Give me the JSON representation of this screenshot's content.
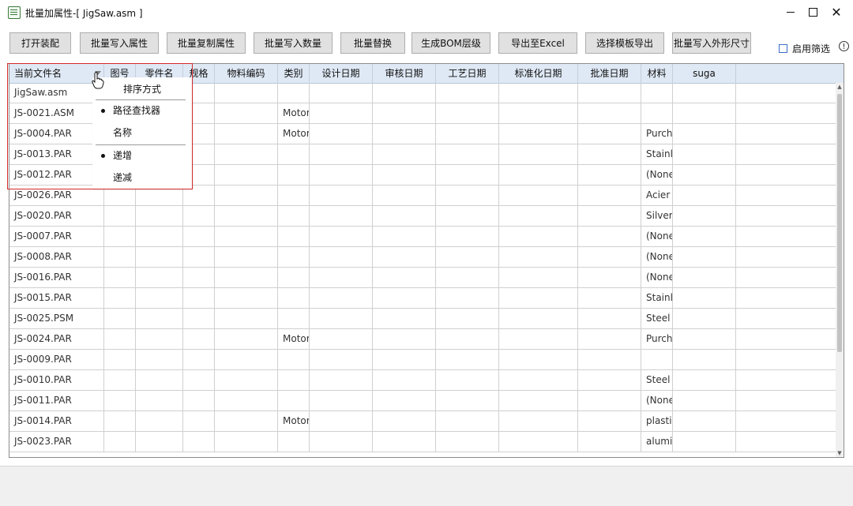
{
  "window": {
    "title": "批量加属性-[ JigSaw.asm ]",
    "minimize_icon": "minimize-icon",
    "maximize_icon": "maximize-icon",
    "close_glyph": "✕"
  },
  "toolbar": {
    "buttons": [
      "打开装配",
      "批量写入属性",
      "批量复制属性",
      "批量写入数量",
      "批量替换",
      "生成BOM层级",
      "导出至Excel",
      "选择模板导出",
      "批量写入外形尺寸"
    ]
  },
  "filter": {
    "label": "启用筛选",
    "checked": false,
    "info_glyph": "!"
  },
  "grid": {
    "columns": [
      "当前文件名",
      "图号",
      "零件名",
      "规格",
      "物料编码",
      "类别",
      "设计日期",
      "审核日期",
      "工艺日期",
      "标准化日期",
      "批准日期",
      "材料",
      "suga",
      ""
    ],
    "rows": [
      {
        "name": "JigSaw.asm",
        "category": "",
        "material": ""
      },
      {
        "name": "JS-0021.ASM",
        "category": "Motor",
        "material": ""
      },
      {
        "name": "JS-0004.PAR",
        "category": "Motor",
        "material": "Purch"
      },
      {
        "name": "JS-0013.PAR",
        "category": "",
        "material": "Stainl"
      },
      {
        "name": "JS-0012.PAR",
        "category": "",
        "material": "(None"
      },
      {
        "name": "JS-0026.PAR",
        "category": "",
        "material": "Acier"
      },
      {
        "name": "JS-0020.PAR",
        "category": "",
        "material": "Silver"
      },
      {
        "name": "JS-0007.PAR",
        "category": "",
        "material": "(None"
      },
      {
        "name": "JS-0008.PAR",
        "category": "",
        "material": "(None"
      },
      {
        "name": "JS-0016.PAR",
        "category": "",
        "material": "(None"
      },
      {
        "name": "JS-0015.PAR",
        "category": "",
        "material": "Stainl"
      },
      {
        "name": "JS-0025.PSM",
        "category": "",
        "material": "Steel"
      },
      {
        "name": "JS-0024.PAR",
        "category": "Motor",
        "material": "Purch"
      },
      {
        "name": "JS-0009.PAR",
        "category": "",
        "material": ""
      },
      {
        "name": "JS-0010.PAR",
        "category": "",
        "material": "Steel"
      },
      {
        "name": "JS-0011.PAR",
        "category": "",
        "material": "(None"
      },
      {
        "name": "JS-0014.PAR",
        "category": "Motor",
        "material": "plastic"
      },
      {
        "name": "JS-0023.PAR",
        "category": "",
        "material": "alumi"
      }
    ]
  },
  "sort_menu": {
    "title": "排序方式",
    "items": [
      {
        "label": "路径查找器",
        "selected": true
      },
      {
        "label": "名称",
        "selected": false
      },
      {
        "label": "递增",
        "selected": true
      },
      {
        "label": "递减",
        "selected": false
      }
    ]
  },
  "colors": {
    "highlight": "#d42a2a",
    "header_bg": "#dfe9f5",
    "button_bg": "#e1e1e1"
  }
}
